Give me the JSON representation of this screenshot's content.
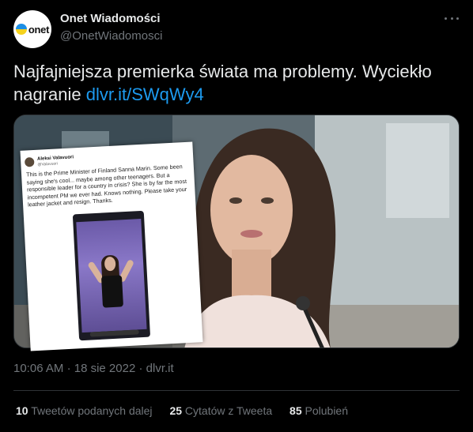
{
  "author": {
    "name": "Onet Wiadomości",
    "handle": "@OnetWiadomosci",
    "avatar_text": "onet"
  },
  "tweet": {
    "text": "Najfajniejsza premierka świata ma problemy. Wyciekło nagranie",
    "link": "dlvr.it/SWqWy4"
  },
  "media": {
    "inset": {
      "author": "Aleksi Valavuori",
      "handle": "@Valavuori",
      "text": "This is the Prime Minister of Finland Sanna Marin. Some been saying she's cool... maybe among other teenagers. But a responsible leader for a country in crisis? She is by far the most incompetent PM we ever had. Knows nothing. Please take your leather jacket and resign. Thanks."
    }
  },
  "meta": {
    "time": "10:06 AM",
    "sep1": "·",
    "date": "18 sie 2022",
    "sep2": "·",
    "source": "dlvr.it"
  },
  "stats": [
    {
      "count": "10",
      "label": "Tweetów podanych dalej"
    },
    {
      "count": "25",
      "label": "Cytatów z Tweeta"
    },
    {
      "count": "85",
      "label": "Polubień"
    }
  ],
  "colors": {
    "background": "#000000",
    "link": "#1d9bf0",
    "secondary_text": "#71767b"
  }
}
